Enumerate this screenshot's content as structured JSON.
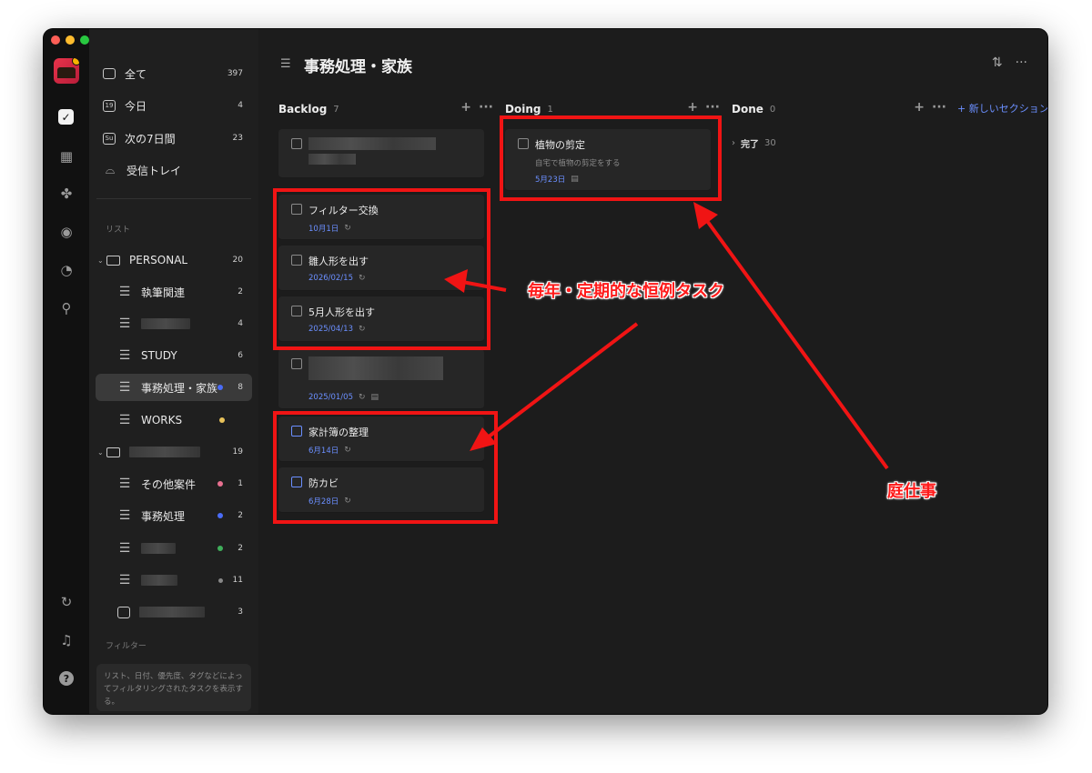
{
  "sidebar": {
    "smart": [
      {
        "label": "全て",
        "count": "397",
        "icon": "inbox-stack-icon"
      },
      {
        "label": "今日",
        "count": "4",
        "icon": "calendar-19-icon",
        "glyph": "19"
      },
      {
        "label": "次の7日間",
        "count": "23",
        "icon": "calendar-su-icon",
        "glyph": "Su"
      },
      {
        "label": "受信トレイ",
        "count": "",
        "icon": "tray-icon"
      }
    ],
    "lists_heading": "リスト",
    "personal": {
      "label": "PERSONAL",
      "count": "20"
    },
    "personal_items": [
      {
        "label": "執筆関連",
        "count": "2"
      },
      {
        "label": "",
        "count": "4"
      },
      {
        "label": "STUDY",
        "count": "6"
      },
      {
        "label": "事務処理・家族",
        "count": "8",
        "dot": "#4a6cf7"
      },
      {
        "label": "WORKS",
        "count": "",
        "dot": "#e8c25a"
      }
    ],
    "folder2": {
      "label": "",
      "count": "19"
    },
    "folder2_items": [
      {
        "label": "その他案件",
        "count": "1",
        "dot": "#e87090"
      },
      {
        "label": "事務処理",
        "count": "2",
        "dot": "#4a6cf7"
      },
      {
        "label": "",
        "count": "2",
        "dot": "#3fae5a"
      },
      {
        "label": "",
        "count": "11",
        "dot": "#888888"
      },
      {
        "label": "",
        "count": "3"
      }
    ],
    "filters_heading": "フィルター",
    "filters_hint": "リスト、日付、優先度、タグなどによってフィルタリングされたタスクを表示する。"
  },
  "main": {
    "title": "事務処理・家族",
    "new_section": "+ 新しいセクション"
  },
  "columns": [
    {
      "name": "Backlog",
      "count": "7"
    },
    {
      "name": "Doing",
      "count": "1"
    },
    {
      "name": "Done",
      "count": "0"
    }
  ],
  "backlog_cards": [
    {
      "title": "",
      "date": ""
    },
    {
      "title": "フィルター交換",
      "date": "10月1日"
    },
    {
      "title": "雛人形を出す",
      "date": "2026/02/15"
    },
    {
      "title": "5月人形を出す",
      "date": "2025/04/13"
    },
    {
      "title": "",
      "date": "2025/01/05"
    },
    {
      "title": "家計簿の整理",
      "date": "6月14日"
    },
    {
      "title": "防カビ",
      "date": "6月28日"
    }
  ],
  "doing_cards": [
    {
      "title": "植物の剪定",
      "desc": "自宅で植物の剪定をする",
      "date": "5月23日"
    }
  ],
  "done_group": {
    "label": "完了",
    "count": "30"
  },
  "annotations": {
    "recurring": "毎年・定期的な恒例タスク",
    "garden": "庭仕事"
  },
  "colors": {
    "accent": "#6b8fff",
    "annotation_red": "#f01414"
  }
}
